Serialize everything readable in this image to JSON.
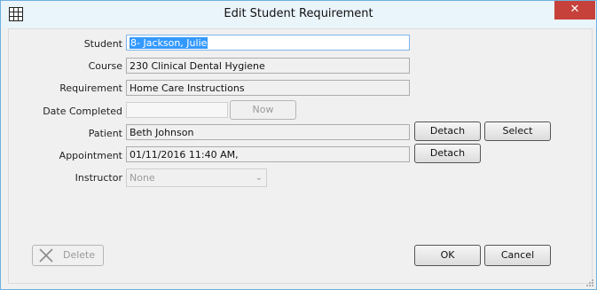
{
  "window": {
    "title": "Edit Student Requirement",
    "close_glyph": "✕"
  },
  "form": {
    "student_label": "Student",
    "student_value": "8- Jackson, Julie",
    "course_label": "Course",
    "course_value": "230 Clinical Dental Hygiene",
    "requirement_label": "Requirement",
    "requirement_value": "Home Care Instructions",
    "date_completed_label": "Date Completed",
    "date_completed_value": "",
    "now_button": "Now",
    "patient_label": "Patient",
    "patient_value": "Beth Johnson",
    "patient_detach_button": "Detach",
    "patient_select_button": "Select",
    "appointment_label": "Appointment",
    "appointment_value": "01/11/2016 11:40 AM,",
    "appointment_detach_button": "Detach",
    "instructor_label": "Instructor",
    "instructor_value": "None"
  },
  "footer": {
    "delete_button": "Delete",
    "ok_button": "OK",
    "cancel_button": "Cancel"
  }
}
